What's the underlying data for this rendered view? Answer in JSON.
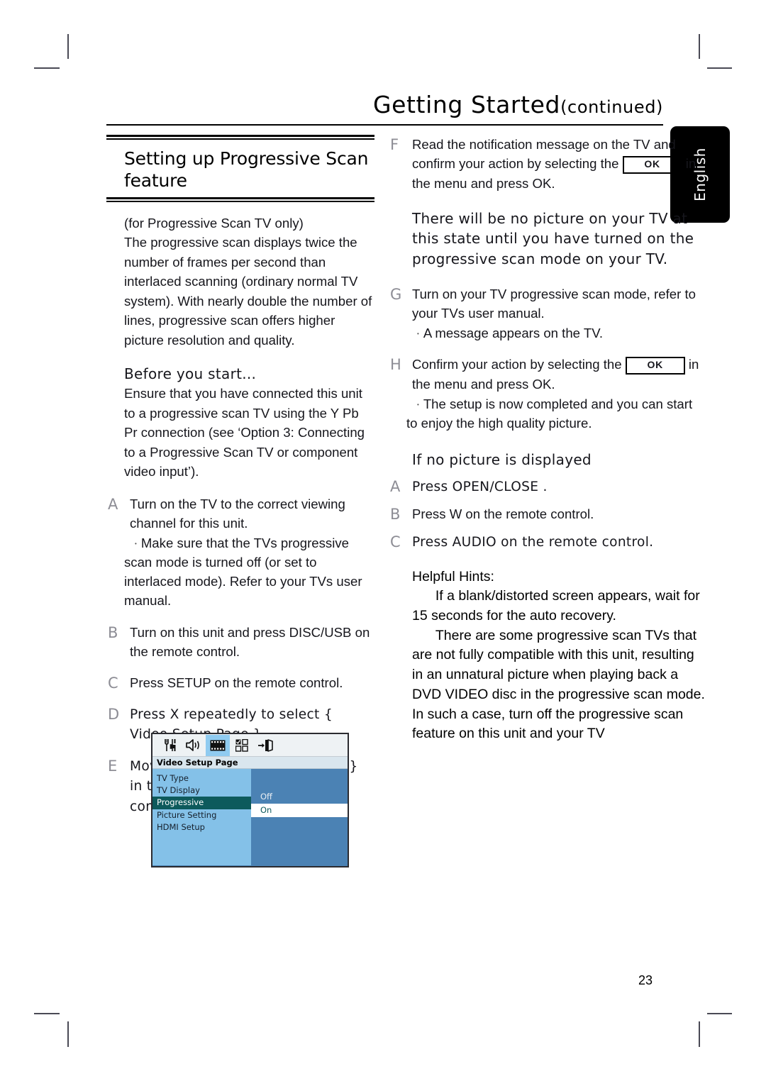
{
  "header": {
    "title_main": "Getting Started",
    "title_cont": "(continued)",
    "language_tab": "English"
  },
  "page_number": "23",
  "left_column": {
    "section_title": "Setting up Progressive Scan feature",
    "intro_line1": "(for Progressive Scan TV only)",
    "intro_body": "The progressive scan displays twice the number of frames per second than interlaced scanning (ordinary normal TV system). With nearly double the number of lines, progressive scan offers higher picture resolution and quality.",
    "before_head": "Before you start...",
    "before_body": "Ensure that you have connected this unit to a progressive scan TV using the Y Pb Pr connection (see ‘Option 3: Connecting to a Progressive Scan TV or component video input’).",
    "steps": [
      {
        "label": "A",
        "text": "Turn on the TV to the correct viewing channel for this unit.",
        "note": "Make sure that the TVs progressive scan mode is turned off (or set to interlaced mode). Refer to your TVs user manual."
      },
      {
        "label": "B",
        "text": "Turn on this unit and press DISC/USB on the remote control."
      },
      {
        "label": "C",
        "text": "Press SETUP on the remote control."
      },
      {
        "label": "D",
        "text": "Press X repeatedly to select { Video Setup Page }."
      },
      {
        "label": "E",
        "text": "Move to { Progressive } > { On } in the menu and press OK to confirm."
      }
    ]
  },
  "osd": {
    "icons": [
      {
        "name": "general-setup-icon",
        "selected": false
      },
      {
        "name": "audio-setup-icon",
        "selected": false
      },
      {
        "name": "video-setup-icon",
        "selected": true
      },
      {
        "name": "preference-setup-icon",
        "selected": false
      },
      {
        "name": "exit-setup-icon",
        "selected": false
      }
    ],
    "title": "Video Setup Page",
    "menu_items": [
      {
        "label": "TV Type",
        "highlighted": false
      },
      {
        "label": "TV Display",
        "highlighted": false
      },
      {
        "label": "Progressive",
        "highlighted": true
      },
      {
        "label": "Picture Setting",
        "highlighted": false
      },
      {
        "label": "HDMI Setup",
        "highlighted": false
      }
    ],
    "options": [
      {
        "label": "Off",
        "selected": false
      },
      {
        "label": "On",
        "selected": true
      }
    ],
    "colors": {
      "menu_panel": "#84c1e8",
      "option_panel": "#4b82b4",
      "highlight": "#0d5a5c",
      "icon_selected": "#8fcbf0"
    }
  },
  "right_column": {
    "steps": [
      {
        "label": "F",
        "text_before": "Read the notification message on the TV and confirm your action by selecting the",
        "ok_label": "OK",
        "text_after": "in the menu and press OK."
      },
      {
        "label": "G",
        "text": "Turn on your TV progressive scan mode, refer to your TVs user manual.",
        "note": "A message appears on the TV."
      },
      {
        "label": "H",
        "text_before": "Confirm your action by selecting the",
        "ok_label": "OK",
        "text_after": "in the menu and press OK.",
        "note": "The setup is now completed and you can start to enjoy the high quality picture."
      }
    ],
    "warning": "There will be no picture on your TV at this state until you have turned on the progressive scan mode on your TV.",
    "no_picture_head": "If no picture is displayed",
    "no_picture_steps": [
      {
        "label": "A",
        "text": "Press OPEN/CLOSE   ."
      },
      {
        "label": "B",
        "text": "Press  W on the remote control."
      },
      {
        "label": "C",
        "text": "Press AUDIO on the remote control."
      }
    ],
    "hints_head": "Helpful Hints:",
    "hint1": "If a blank/distorted screen appears, wait for 15 seconds for the auto recovery.",
    "hint2": "There are some progressive scan TVs that are not fully compatible with this unit, resulting in an unnatural picture when playing back a DVD VIDEO disc in the progressive scan mode. In such a case, turn off the progressive scan feature on this unit and your TV"
  }
}
